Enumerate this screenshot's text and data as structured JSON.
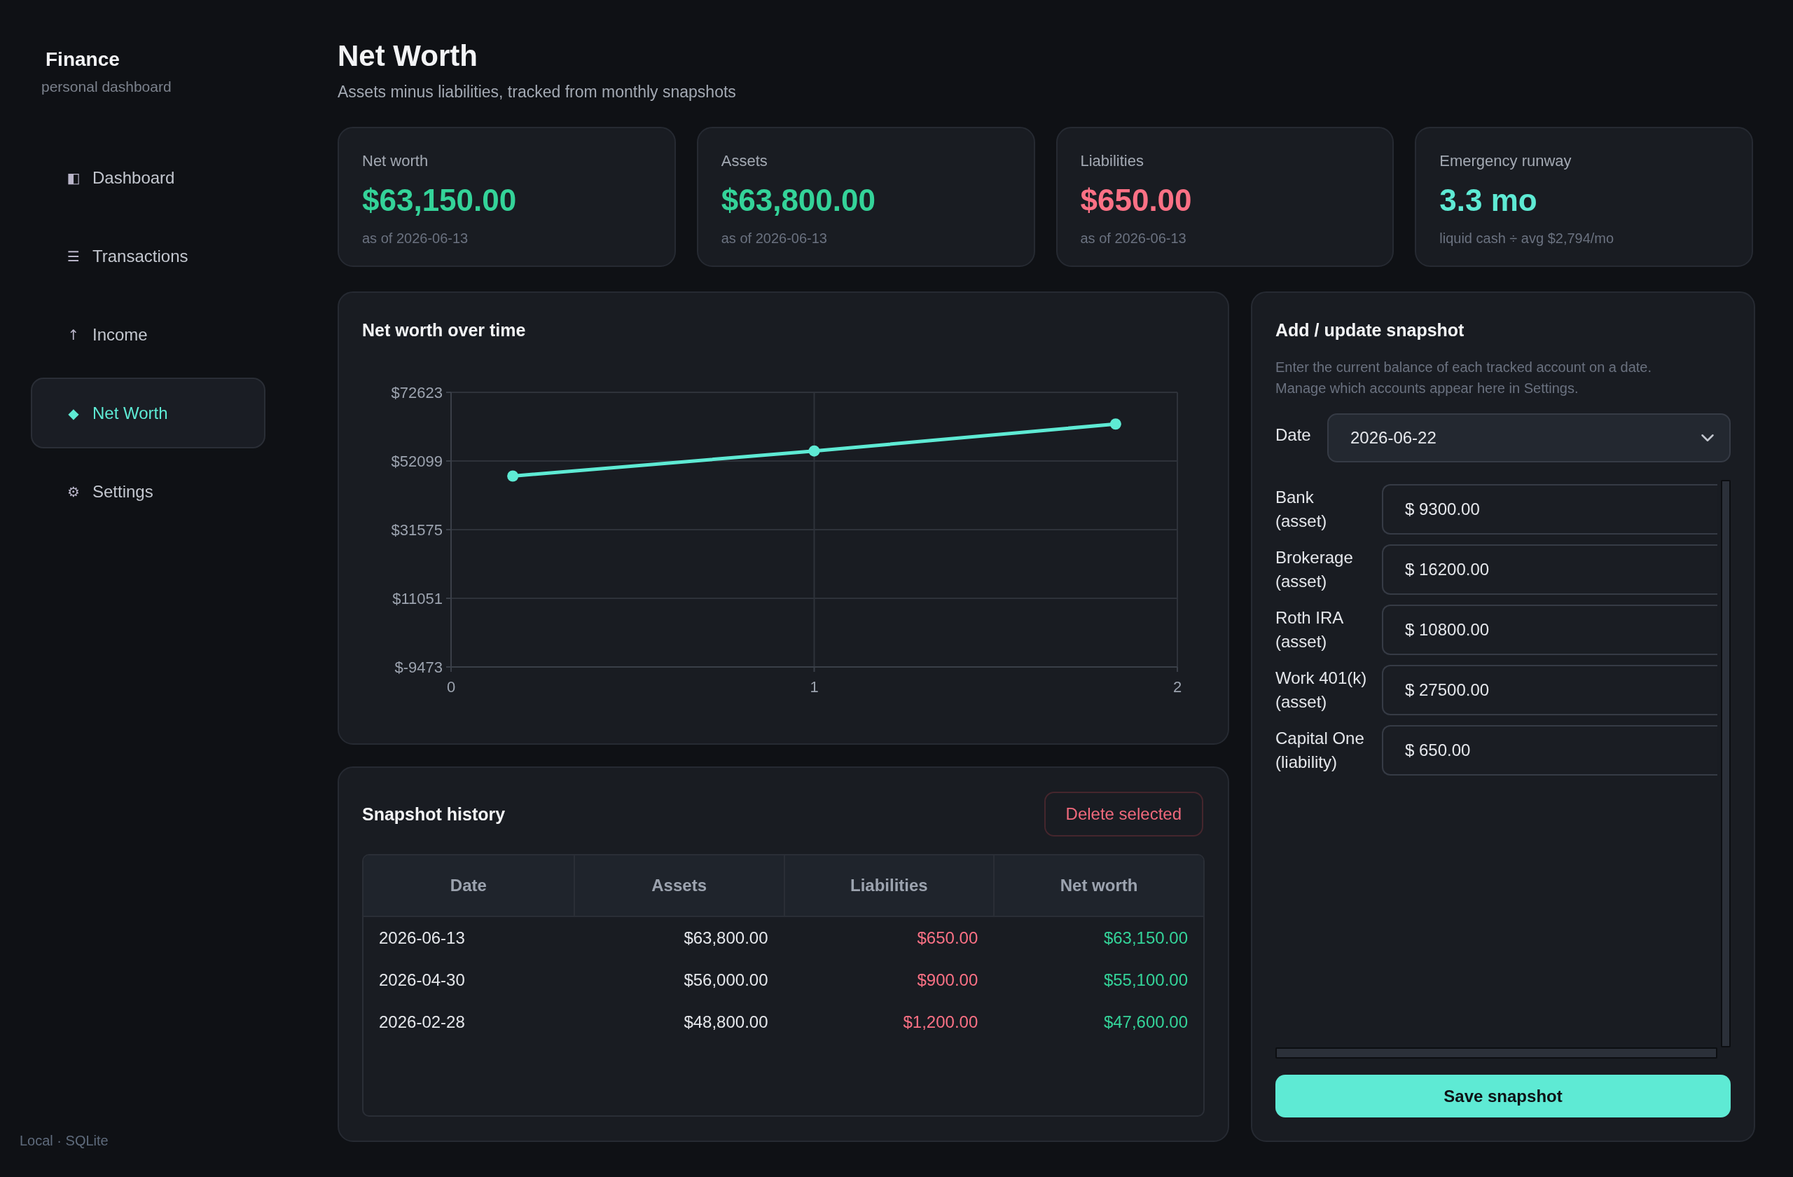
{
  "sidebar": {
    "brand": {
      "title": "Finance",
      "subtitle": "personal dashboard"
    },
    "items": [
      {
        "icon": "◧",
        "label": "Dashboard",
        "selected": false
      },
      {
        "icon": "☰",
        "label": "Transactions",
        "selected": false
      },
      {
        "icon": "↑",
        "label": "Income",
        "selected": false
      },
      {
        "icon": "◆",
        "label": "Net Worth",
        "selected": true
      },
      {
        "icon": "⚙",
        "label": "Settings",
        "selected": false
      }
    ],
    "footer": "Local · SQLite"
  },
  "header": {
    "title": "Net Worth",
    "subtitle": "Assets minus liabilities, tracked from monthly snapshots"
  },
  "stats": [
    {
      "label": "Net worth",
      "value": "$63,150.00",
      "note": "as of 2026-06-13",
      "color": "#34d399"
    },
    {
      "label": "Assets",
      "value": "$63,800.00",
      "note": "as of 2026-06-13",
      "color": "#34d399"
    },
    {
      "label": "Liabilities",
      "value": "$650.00",
      "note": "as of 2026-06-13",
      "color": "#fb7185"
    },
    {
      "label": "Emergency runway",
      "value": "3.3 mo",
      "note": "liquid cash ÷ avg $2,794/mo",
      "color": "#5eead4"
    }
  ],
  "chart": {
    "chart_data": {
      "type": "line",
      "title": "Net worth over time",
      "grid": true,
      "x": [
        0.17,
        1,
        1.83
      ],
      "series": [
        {
          "color": "#5eead4",
          "marker": true,
          "values": [
            47600,
            55100,
            63150
          ]
        }
      ],
      "xlim": [
        0,
        2
      ],
      "ylim": [
        -9473,
        72623
      ],
      "xticks": [
        0,
        1,
        2
      ],
      "yticks": [
        {
          "value": 72623,
          "label": "$72623"
        },
        {
          "value": 52099,
          "label": "$52099"
        },
        {
          "value": 31575,
          "label": "$31575"
        },
        {
          "value": 11051,
          "label": "$11051"
        },
        {
          "value": -9473,
          "label": "$-9473"
        }
      ]
    }
  },
  "history": {
    "title": "Snapshot history",
    "delete_button": "Delete selected",
    "columns": [
      "Date",
      "Assets",
      "Liabilities",
      "Net worth"
    ],
    "rows": [
      [
        "2026-06-13",
        "$63,800.00",
        "$650.00",
        "$63,150.00"
      ],
      [
        "2026-04-30",
        "$56,000.00",
        "$900.00",
        "$55,100.00"
      ],
      [
        "2026-02-28",
        "$48,800.00",
        "$1,200.00",
        "$47,600.00"
      ]
    ]
  },
  "snapshot_form": {
    "title": "Add / update snapshot",
    "description": "Enter the current balance of each tracked account on a date. Manage which accounts appear here in Settings.",
    "date": {
      "label": "Date",
      "value": "2026-06-22"
    },
    "accounts": [
      {
        "name": "Bank",
        "type": "(asset)",
        "value": "$ 9300.00"
      },
      {
        "name": "Brokerage",
        "type": "(asset)",
        "value": "$ 16200.00"
      },
      {
        "name": "Roth IRA",
        "type": "(asset)",
        "value": "$ 10800.00"
      },
      {
        "name": "Work 401(k)",
        "type": "(asset)",
        "value": "$ 27500.00"
      },
      {
        "name": "Capital One",
        "type": "(liability)",
        "value": "$ 650.00"
      }
    ],
    "save_button": "Save snapshot"
  }
}
